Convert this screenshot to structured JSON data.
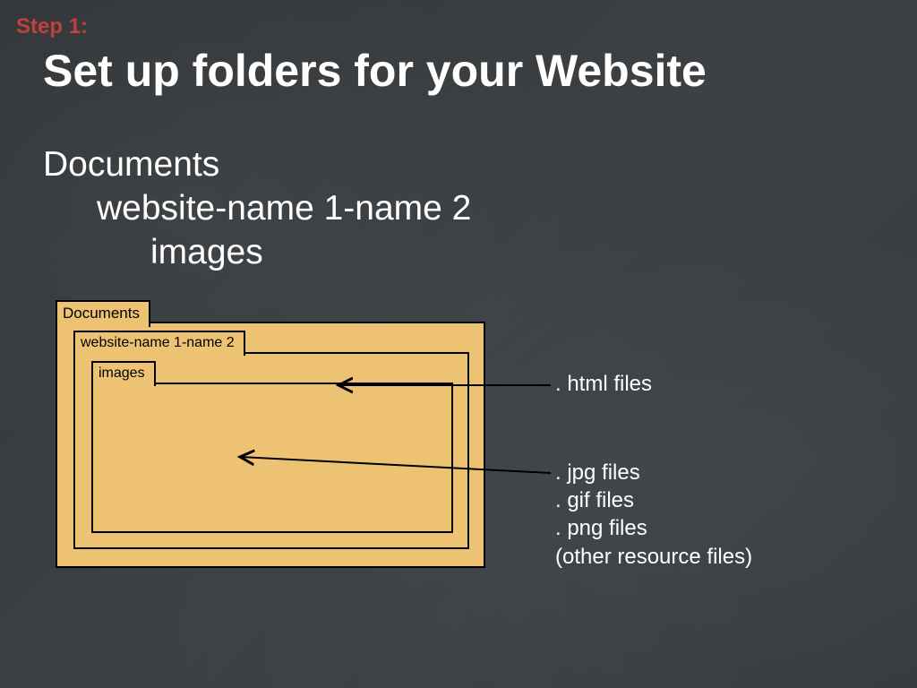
{
  "step_label": "Step 1:",
  "title": "Set up folders for your Website",
  "folder_list": {
    "level0": "Documents",
    "level1": "website-name 1-name 2",
    "level2": "images"
  },
  "diagram": {
    "outer_tab": "Documents",
    "middle_tab": "website-name 1-name 2",
    "inner_tab": "images"
  },
  "annotations": {
    "html": ". html files",
    "files": {
      "line1": ". jpg files",
      "line2": ". gif files",
      "line3": ". png files",
      "line4": "(other resource files)"
    }
  }
}
